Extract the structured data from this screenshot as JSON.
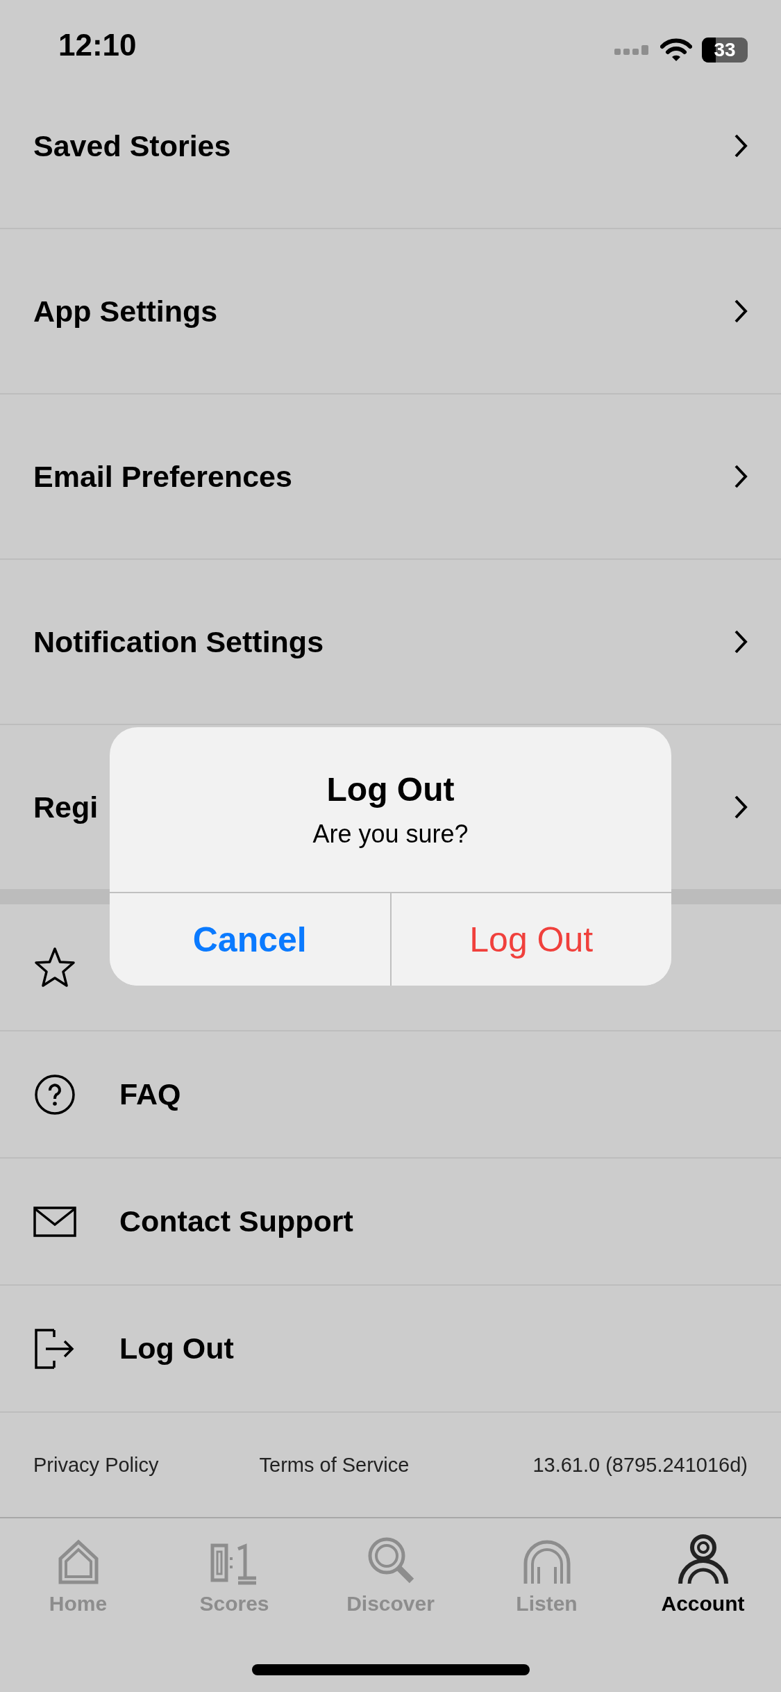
{
  "status_bar": {
    "time": "12:10",
    "battery": "33"
  },
  "menu": [
    {
      "label": "Saved Stories"
    },
    {
      "label": "App Settings"
    },
    {
      "label": "Email Preferences"
    },
    {
      "label": "Notification Settings"
    },
    {
      "label": "Regi"
    }
  ],
  "links": [
    {
      "kind": "star"
    },
    {
      "kind": "question",
      "label": "FAQ"
    },
    {
      "kind": "mail",
      "label": "Contact Support"
    },
    {
      "kind": "logout",
      "label": "Log Out"
    }
  ],
  "dialog": {
    "title": "Log Out",
    "message": "Are you sure?",
    "buttons": [
      {
        "label": "Cancel",
        "kind": "cancel"
      },
      {
        "label": "Log Out",
        "kind": "destructive"
      }
    ]
  },
  "footer": {
    "links": [
      "Privacy Policy",
      "Terms of Service"
    ],
    "version": "13.61.0 (8795.241016d)"
  },
  "tabs": [
    {
      "label": "Home",
      "kind": "home",
      "selected": false
    },
    {
      "label": "Scores",
      "kind": "scores",
      "selected": false
    },
    {
      "label": "Discover",
      "kind": "discover",
      "selected": false
    },
    {
      "label": "Listen",
      "kind": "listen",
      "selected": false
    },
    {
      "label": "Account",
      "kind": "account",
      "selected": true
    }
  ]
}
